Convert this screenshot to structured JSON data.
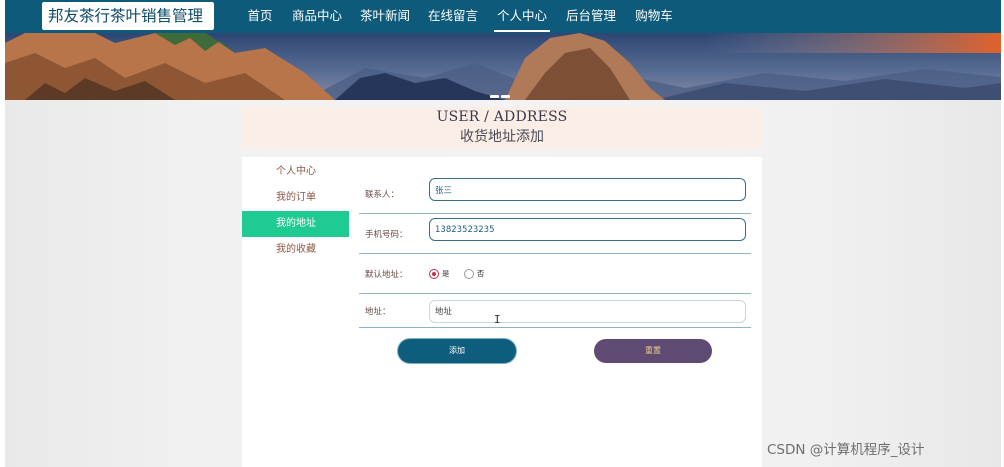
{
  "brand": "邦友茶行茶叶销售管理",
  "nav": {
    "items": [
      "首页",
      "商品中心",
      "茶叶新闻",
      "在线留言",
      "个人中心",
      "后台管理",
      "购物车"
    ],
    "active": "个人中心"
  },
  "page_title": {
    "en": "USER / ADDRESS",
    "cn": "收货地址添加"
  },
  "sidebar": {
    "items": [
      "个人中心",
      "我的订单",
      "我的地址",
      "我的收藏"
    ],
    "active": "我的地址"
  },
  "form": {
    "contact_label": "联系人：",
    "contact_value": "张三",
    "phone_label": "手机号码：",
    "phone_value": "13823523235",
    "default_label": "默认地址：",
    "default_options": [
      "是",
      "否"
    ],
    "default_selected": "是",
    "address_label": "地址：",
    "address_placeholder": "地址"
  },
  "buttons": {
    "add": "添加",
    "reset": "重置"
  },
  "watermark": "CSDN @计算机程序_设计",
  "colors": {
    "nav_bg": "#0d5a7a",
    "active_sidebar": "#1fcb93",
    "add_button": "#0f5d7d",
    "reset_button": "#5e4a73"
  }
}
